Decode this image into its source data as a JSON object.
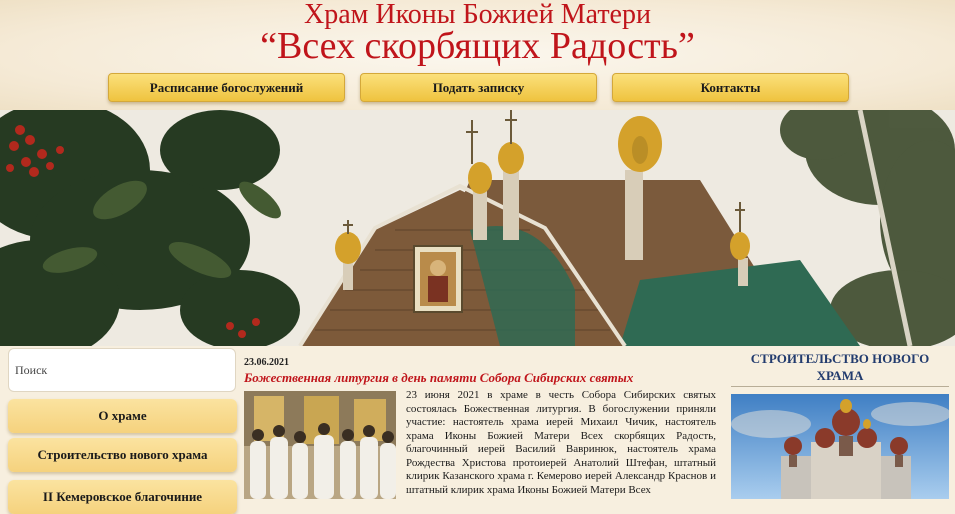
{
  "header": {
    "title_line1": "Храм Иконы Божией Матери",
    "title_line2": "“Всех скорбящих Радость”"
  },
  "nav": [
    {
      "label": "Расписание богослужений"
    },
    {
      "label": "Подать записку"
    },
    {
      "label": "Контакты"
    }
  ],
  "search": {
    "placeholder": "Поиск"
  },
  "sidebar": {
    "items": [
      {
        "label": "О храме"
      },
      {
        "label": "Строительство нового храма"
      },
      {
        "label": "II Кемеровское благочиние"
      }
    ]
  },
  "post": {
    "date": "23.06.2021",
    "title": "Божественная литургия в день памяти Собора Сибирских святых",
    "text": "23 июня 2021 в храме в честь Собора Сибирских святых состоялась Божественная литургия. В богослужении приняли участие: настоятель храма иерей Михаил Чичик, настоятель храма Иконы Божией Матери Всех скорбящих Радость, благочинный иерей Василий Вавринюк, настоятель храма Рождества Христова протоиерей Анатолий Штефан, штатный клирик Казанского храма г. Кемерово иерей Александр Краснов и штатный клирик храма Иконы Божией Матери Всех"
  },
  "right": {
    "title": "СТРОИТЕЛЬСТВО НОВОГО ХРАМА"
  },
  "colors": {
    "accent": "#c0151b",
    "button": "#f5c94a",
    "heading_blue": "#223b6e",
    "background": "#f7efdf"
  }
}
